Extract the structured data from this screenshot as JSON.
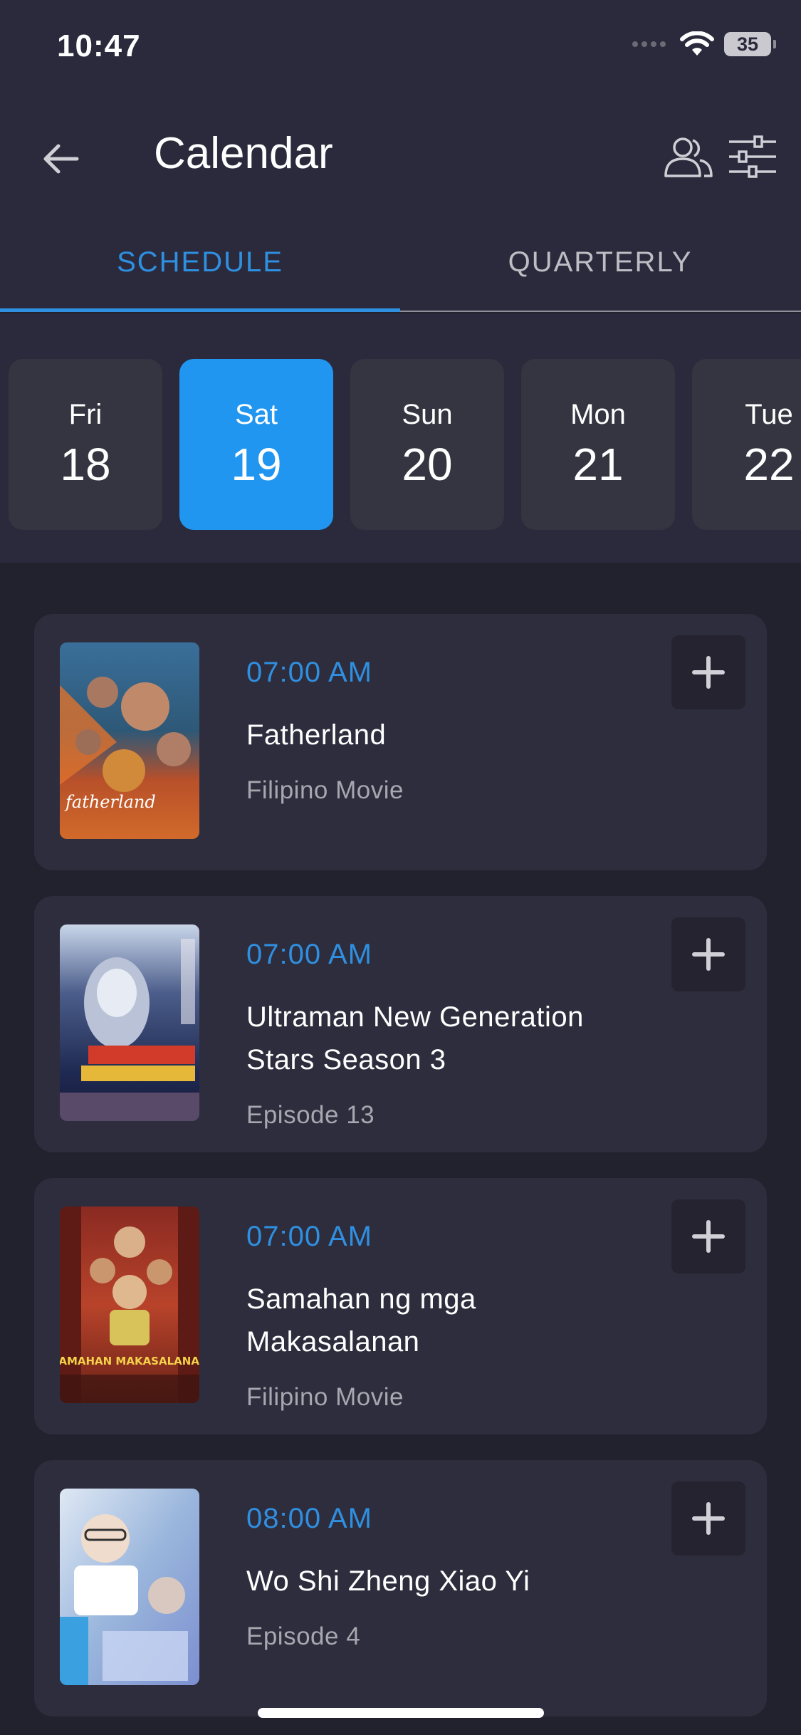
{
  "status_bar": {
    "time": "10:47",
    "battery": "35"
  },
  "header": {
    "title": "Calendar"
  },
  "tabs": [
    {
      "label": "SCHEDULE",
      "active": true
    },
    {
      "label": "QUARTERLY",
      "active": false
    }
  ],
  "days": [
    {
      "name": "Fri",
      "num": "18",
      "selected": false
    },
    {
      "name": "Sat",
      "num": "19",
      "selected": true
    },
    {
      "name": "Sun",
      "num": "20",
      "selected": false
    },
    {
      "name": "Mon",
      "num": "21",
      "selected": false
    },
    {
      "name": "Tue",
      "num": "22",
      "selected": false
    }
  ],
  "schedule": [
    {
      "time": "07:00 AM",
      "title": "Fatherland",
      "subtitle": "Filipino Movie",
      "poster_text": "fatherland"
    },
    {
      "time": "07:00 AM",
      "title": "Ultraman New Generation Stars Season 3",
      "subtitle": "Episode 13",
      "poster_text": ""
    },
    {
      "time": "07:00 AM",
      "title": "Samahan ng mga Makasalanan",
      "subtitle": "Filipino Movie",
      "poster_text": "SAMAHAN MAKASALANAN"
    },
    {
      "time": "08:00 AM",
      "title": "Wo Shi Zheng Xiao Yi",
      "subtitle": "Episode 4",
      "poster_text": ""
    }
  ],
  "colors": {
    "accent": "#2196f0",
    "background": "#22212e",
    "card": "#2e2d3d"
  }
}
